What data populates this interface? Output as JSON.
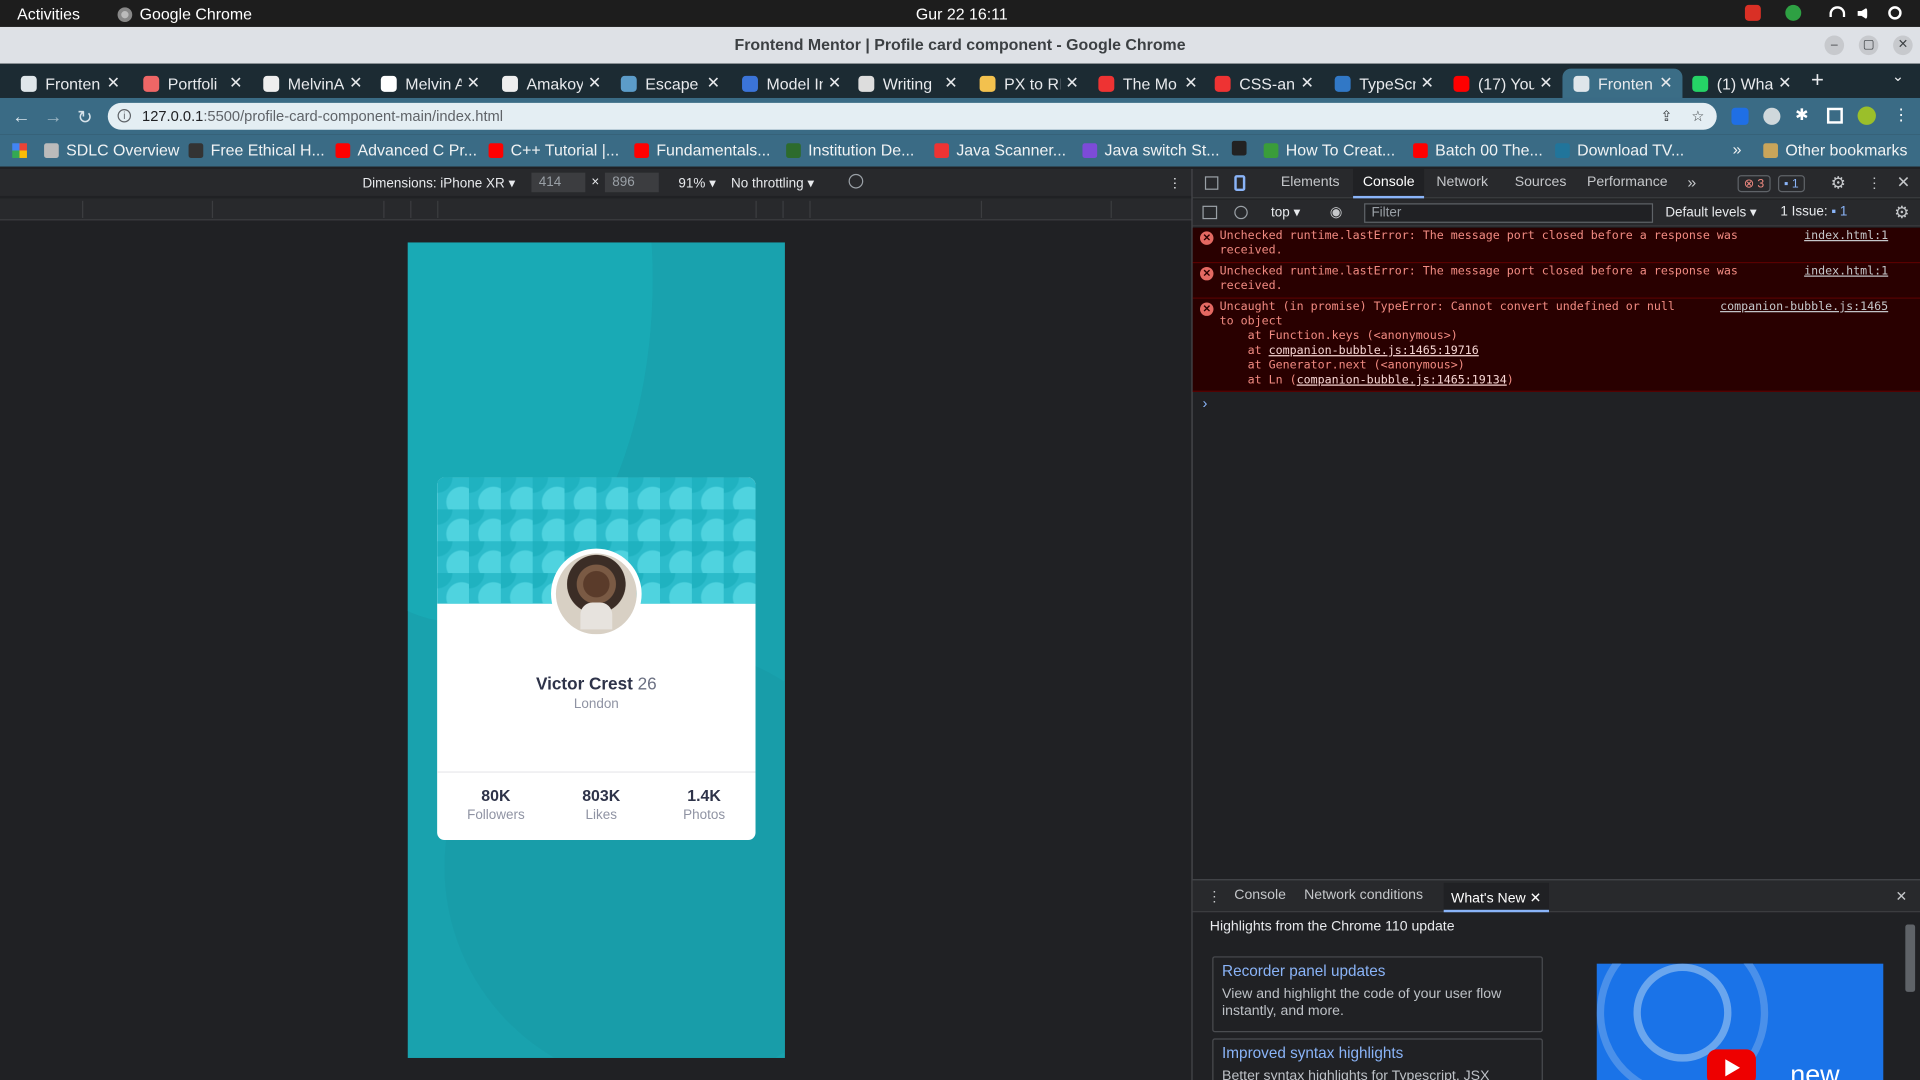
{
  "gnome": {
    "activities": "Activities",
    "app": "Google Chrome",
    "clock": "Gur 22  16:11"
  },
  "window": {
    "title": "Frontend Mentor | Profile card component - Google Chrome"
  },
  "tabs": [
    {
      "label": "Fronten",
      "color": "#dfe6ea"
    },
    {
      "label": "Portfoli",
      "color": "#e66"
    },
    {
      "label": "MelvinA",
      "color": "#eee"
    },
    {
      "label": "Melvin A",
      "color": "#fff"
    },
    {
      "label": "Amakoy",
      "color": "#eee"
    },
    {
      "label": "Escape i",
      "color": "#5c9cc9"
    },
    {
      "label": "Model In",
      "color": "#3b74d8"
    },
    {
      "label": "Writing",
      "color": "#ddd"
    },
    {
      "label": "PX to RE",
      "color": "#f3c14e"
    },
    {
      "label": "The Mo",
      "color": "#e33"
    },
    {
      "label": "CSS-ani",
      "color": "#e33"
    },
    {
      "label": "TypeScr",
      "color": "#3178c6"
    },
    {
      "label": "(17) You",
      "color": "#f00"
    },
    {
      "label": "Fronten",
      "color": "#dfe6ea",
      "active": true
    },
    {
      "label": "(1) Wha",
      "color": "#25d366"
    }
  ],
  "address": {
    "host": "127.0.0.1",
    "path": ":5500/profile-card-component-main/index.html"
  },
  "bookmarks": [
    {
      "label": "SDLC Overview",
      "color": "#bbb"
    },
    {
      "label": "Free Ethical H...",
      "color": "#333"
    },
    {
      "label": "Advanced C Pr...",
      "color": "#f00"
    },
    {
      "label": "C++ Tutorial |...",
      "color": "#f00"
    },
    {
      "label": "Fundamentals...",
      "color": "#f00"
    },
    {
      "label": "Institution De...",
      "color": "#2d6b2d"
    },
    {
      "label": "Java Scanner...",
      "color": "#e33"
    },
    {
      "label": "Java switch St...",
      "color": "#7d4bd8"
    },
    {
      "label": "",
      "color": "#222"
    },
    {
      "label": "How To Creat...",
      "color": "#3a9d3a"
    },
    {
      "label": "Batch 00 The...",
      "color": "#f00"
    },
    {
      "label": "Download TV...",
      "color": "#21759b"
    }
  ],
  "bookmarks_more": "»",
  "other_bookmarks": "Other bookmarks",
  "device": {
    "dimensions": "Dimensions: iPhone XR",
    "width": "414",
    "height": "896",
    "zoom": "91%",
    "throttle": "No throttling",
    "times": "×"
  },
  "profile": {
    "name": "Victor Crest",
    "age": "26",
    "location": "London",
    "stats": [
      {
        "value": "80K",
        "label": "Followers"
      },
      {
        "value": "803K",
        "label": "Likes"
      },
      {
        "value": "1.4K",
        "label": "Photos"
      }
    ]
  },
  "devtools": {
    "tabs": [
      "Elements",
      "Console",
      "Network",
      "Sources",
      "Performance"
    ],
    "more": "»",
    "errors": "3",
    "issues_badge": "1",
    "context": "top",
    "filter_placeholder": "Filter",
    "levels": "Default levels",
    "issue": "1 Issue:",
    "issue_count": "1",
    "messages": [
      {
        "text": "Unchecked runtime.lastError: The message port closed before a response was\nreceived.",
        "source": "index.html:1"
      },
      {
        "text": "Unchecked runtime.lastError: The message port closed before a response was\nreceived.",
        "source": "index.html:1"
      }
    ],
    "error3": {
      "line1": "Uncaught (in promise) TypeError: Cannot convert undefined or null",
      "line2": "to object",
      "s1": "    at Function.keys (<anonymous>)",
      "s2a": "    at ",
      "s2b": "companion-bubble.js:1465:19716",
      "s3": "    at Generator.next (<anonymous>)",
      "s4a": "    at Ln (",
      "s4b": "companion-bubble.js:1465:19134",
      "s4c": ")",
      "source": "companion-bubble.js:1465"
    },
    "prompt": "›"
  },
  "drawer": {
    "tabs": [
      "Console",
      "Network conditions"
    ],
    "active": "What's New",
    "heading": "Highlights from the Chrome 110 update",
    "cards": [
      {
        "title": "Recorder panel updates",
        "desc": "View and highlight the code of your user flow instantly, and more."
      },
      {
        "title": "Improved syntax highlights",
        "desc": "Better syntax highlights for Typescript, JSX"
      }
    ],
    "video_text": "new"
  }
}
